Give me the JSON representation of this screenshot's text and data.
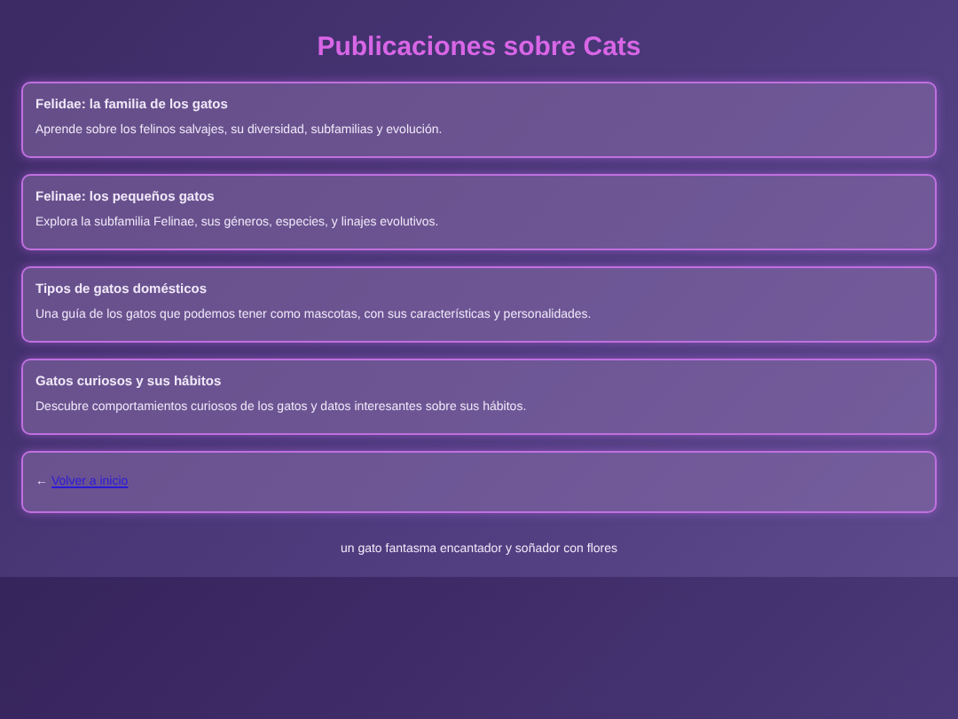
{
  "title": "Publicaciones sobre Cats",
  "posts": [
    {
      "title": "Felidae: la familia de los gatos",
      "description": "Aprende sobre los felinos salvajes, su diversidad, subfamilias y evolución."
    },
    {
      "title": "Felinae: los pequeños gatos",
      "description": "Explora la subfamilia Felinae, sus géneros, especies, y linajes evolutivos."
    },
    {
      "title": "Tipos de gatos domésticos",
      "description": "Una guía de los gatos que podemos tener como mascotas, con sus características y personalidades."
    },
    {
      "title": "Gatos curiosos y sus hábitos",
      "description": "Descubre comportamientos curiosos de los gatos y datos interesantes sobre sus hábitos."
    }
  ],
  "back": {
    "arrow": "←",
    "link": "Volver a inicio"
  },
  "footer": "un gato fantasma encantador y soñador con flores"
}
